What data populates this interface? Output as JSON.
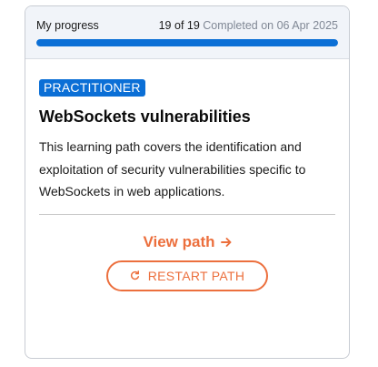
{
  "progress": {
    "label": "My progress",
    "count": "19 of 19",
    "completed": "Completed on 06 Apr 2025",
    "fraction": 1.0
  },
  "path": {
    "level": "PRACTITIONER",
    "title": "WebSockets vulnerabilities",
    "description": "This learning path covers the identification and exploitation of security vulnerabilities specific to WebSockets in web applications."
  },
  "actions": {
    "view_label": "View path",
    "view_icon": "arrow-right-icon",
    "restart_label": "RESTART PATH",
    "restart_icon": "restart-icon"
  },
  "colors": {
    "accent_blue": "#0b6fd6",
    "accent_orange": "#ec6f3d"
  }
}
